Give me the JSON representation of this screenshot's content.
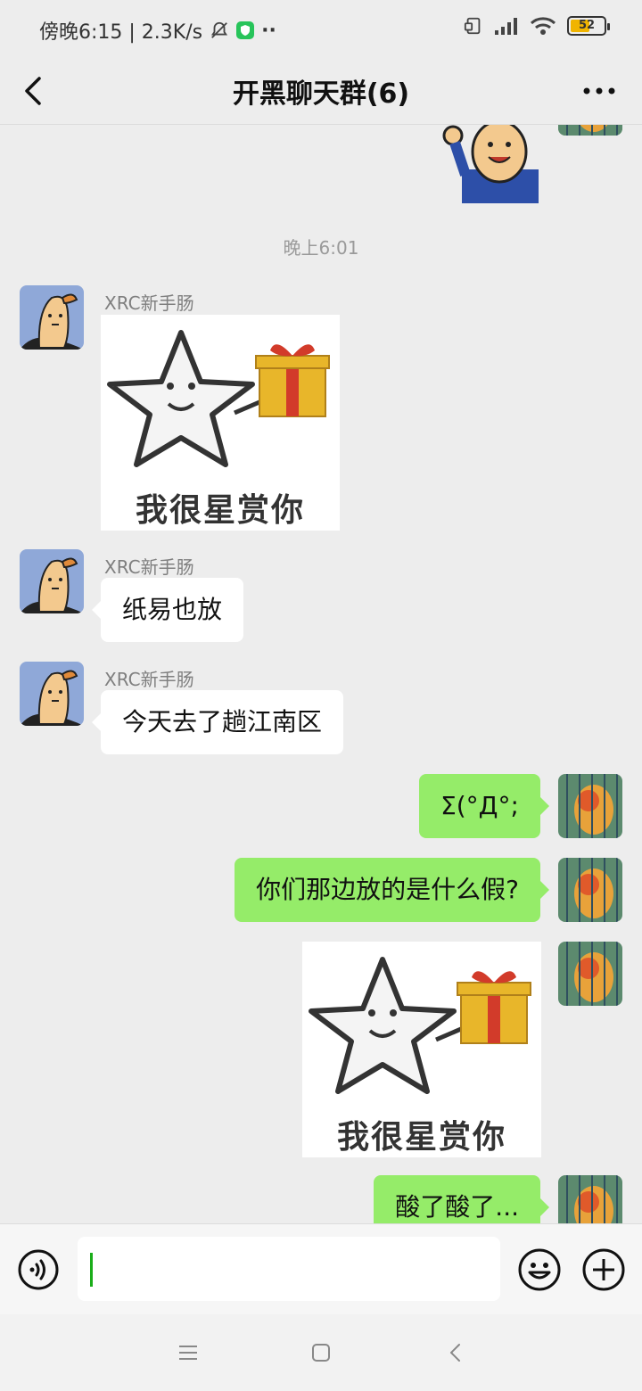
{
  "status_bar": {
    "time_text": "傍晚6:15 | 2.3K/s",
    "battery": "52"
  },
  "header": {
    "title": "开黑聊天群(6)"
  },
  "chat": {
    "timestamp": "晚上6:01",
    "messages": [
      {
        "sender": "XRC新手肠",
        "type": "sticker",
        "caption": "我很星赏你"
      },
      {
        "sender": "XRC新手肠",
        "type": "text",
        "text": "纸易也放"
      },
      {
        "sender": "XRC新手肠",
        "type": "text",
        "text": "今天去了趟江南区"
      },
      {
        "sender": "me",
        "type": "text",
        "text": "Σ(°Д°;"
      },
      {
        "sender": "me",
        "type": "text",
        "text": "你们那边放的是什么假?"
      },
      {
        "sender": "me",
        "type": "sticker",
        "caption": "我很星赏你"
      },
      {
        "sender": "me",
        "type": "text",
        "text": "酸了酸了..."
      }
    ]
  },
  "input": {
    "value": ""
  },
  "colors": {
    "background": "#ededed",
    "bubble_out": "#95ec69",
    "bubble_in": "#ffffff",
    "accent": "#1aad19"
  },
  "icons": [
    "back-arrow-icon",
    "more-icon",
    "voice-icon",
    "emoji-icon",
    "plus-icon",
    "menu-nav-icon",
    "home-nav-icon",
    "back-nav-icon",
    "bell-off-icon",
    "shield-icon",
    "signal-icon",
    "wifi-icon",
    "battery-icon"
  ]
}
